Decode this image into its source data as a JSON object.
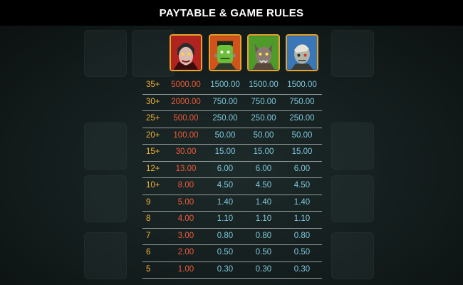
{
  "header": {
    "title": "PAYTABLE & GAME RULES"
  },
  "symbols": [
    {
      "icon": "vampire-icon",
      "border_color": "#e8a42a"
    },
    {
      "icon": "frankenstein-icon",
      "border_color": "#e8a42a"
    },
    {
      "icon": "werewolf-icon",
      "border_color": "#e8a42a"
    },
    {
      "icon": "zombie-icon",
      "border_color": "#e8a42a"
    }
  ],
  "colors": {
    "count": "#f1b23b",
    "top_symbol": "#f05a3a",
    "other_symbols": "#7fc8dc"
  },
  "paytable": [
    {
      "count": "35+",
      "values": [
        "5000.00",
        "1500.00",
        "1500.00",
        "1500.00"
      ]
    },
    {
      "count": "30+",
      "values": [
        "2000.00",
        "750.00",
        "750.00",
        "750.00"
      ]
    },
    {
      "count": "25+",
      "values": [
        "500.00",
        "250.00",
        "250.00",
        "250.00"
      ]
    },
    {
      "count": "20+",
      "values": [
        "100.00",
        "50.00",
        "50.00",
        "50.00"
      ]
    },
    {
      "count": "15+",
      "values": [
        "30.00",
        "15.00",
        "15.00",
        "15.00"
      ]
    },
    {
      "count": "12+",
      "values": [
        "13.00",
        "6.00",
        "6.00",
        "6.00"
      ]
    },
    {
      "count": "10+",
      "values": [
        "8.00",
        "4.50",
        "4.50",
        "4.50"
      ]
    },
    {
      "count": "9",
      "values": [
        "5.00",
        "1.40",
        "1.40",
        "1.40"
      ]
    },
    {
      "count": "8",
      "values": [
        "4.00",
        "1.10",
        "1.10",
        "1.10"
      ]
    },
    {
      "count": "7",
      "values": [
        "3.00",
        "0.80",
        "0.80",
        "0.80"
      ]
    },
    {
      "count": "6",
      "values": [
        "2.00",
        "0.50",
        "0.50",
        "0.50"
      ]
    },
    {
      "count": "5",
      "values": [
        "1.00",
        "0.30",
        "0.30",
        "0.30"
      ]
    }
  ]
}
